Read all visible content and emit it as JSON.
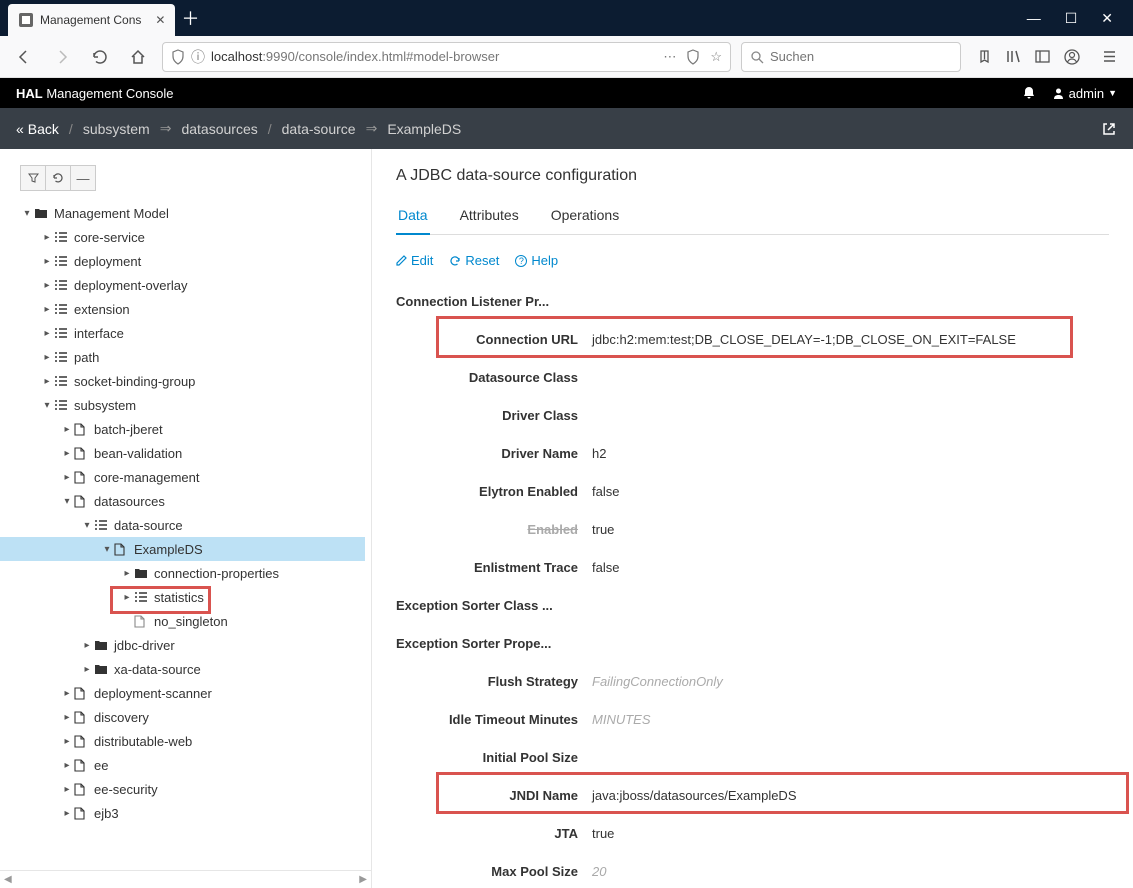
{
  "browser": {
    "tab_title": "Management Cons",
    "url_host": "localhost",
    "url_port": ":9990",
    "url_path": "/console/index.html#model-browser",
    "search_placeholder": "Suchen"
  },
  "header": {
    "brand_bold": "HAL",
    "brand_rest": " Management Console",
    "user_label": "admin"
  },
  "breadcrumb": {
    "back": "Back",
    "items": [
      "subsystem",
      "datasources",
      "data-source",
      "ExampleDS"
    ]
  },
  "tree": {
    "root": "Management Model",
    "nodes_top": [
      "core-service",
      "deployment",
      "deployment-overlay",
      "extension",
      "interface",
      "path",
      "socket-binding-group"
    ],
    "subsystem": "subsystem",
    "subsystem_children_pre": [
      "batch-jberet",
      "bean-validation",
      "core-management"
    ],
    "datasources": "datasources",
    "data_source": "data-source",
    "example_ds": "ExampleDS",
    "example_ds_children": [
      {
        "icon": "folder",
        "label": "connection-properties"
      },
      {
        "icon": "list",
        "label": "statistics"
      },
      {
        "icon": "file",
        "label": "no_singleton"
      }
    ],
    "datasources_siblings": [
      {
        "icon": "folder",
        "label": "jdbc-driver"
      },
      {
        "icon": "folder",
        "label": "xa-data-source"
      }
    ],
    "subsystem_children_post": [
      "deployment-scanner",
      "discovery",
      "distributable-web",
      "ee",
      "ee-security",
      "ejb3"
    ]
  },
  "content": {
    "title": "A JDBC data-source configuration",
    "tabs": [
      "Data",
      "Attributes",
      "Operations"
    ],
    "actions": {
      "edit": "Edit",
      "reset": "Reset",
      "help": "Help"
    },
    "attributes": [
      {
        "label": "Connection Listener Pr...",
        "section": true
      },
      {
        "label": "Connection URL",
        "value": "jdbc:h2:mem:test;DB_CLOSE_DELAY=-1;DB_CLOSE_ON_EXIT=FALSE",
        "highlight": true
      },
      {
        "label": "Datasource Class",
        "value": ""
      },
      {
        "label": "Driver Class",
        "value": ""
      },
      {
        "label": "Driver Name",
        "value": "h2"
      },
      {
        "label": "Elytron Enabled",
        "value": "false"
      },
      {
        "label": "Enabled",
        "value": "true",
        "strike_label": true
      },
      {
        "label": "Enlistment Trace",
        "value": "false"
      },
      {
        "label": "Exception Sorter Class ...",
        "section": true
      },
      {
        "label": "Exception Sorter Prope...",
        "section": true
      },
      {
        "label": "Flush Strategy",
        "value": "FailingConnectionOnly",
        "placeholder": true
      },
      {
        "label": "Idle Timeout Minutes",
        "value": "MINUTES",
        "placeholder": true
      },
      {
        "label": "Initial Pool Size",
        "value": ""
      },
      {
        "label": "JNDI Name",
        "value": "java:jboss/datasources/ExampleDS",
        "highlight2": true
      },
      {
        "label": "JTA",
        "value": "true"
      },
      {
        "label": "Max Pool Size",
        "value": "20",
        "placeholder": true
      }
    ]
  }
}
